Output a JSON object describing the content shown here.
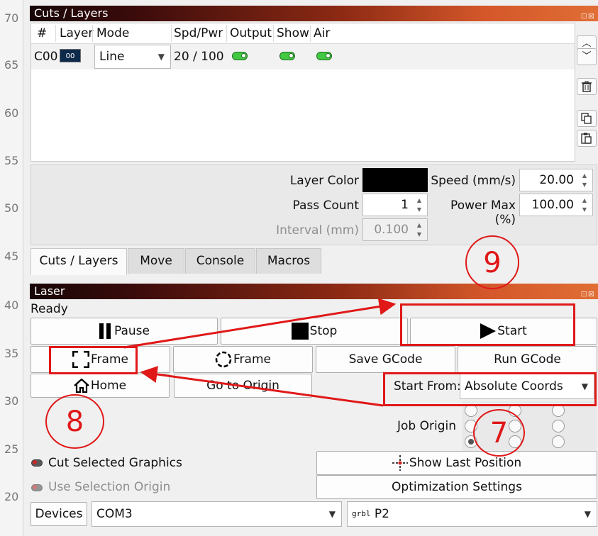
{
  "ruler": {
    "ticks": [
      "70",
      "65",
      "60",
      "55",
      "50",
      "45",
      "40",
      "35",
      "30",
      "25",
      "20"
    ]
  },
  "cuts_panel": {
    "title": "Cuts / Layers",
    "columns": [
      "#",
      "Layer",
      "Mode",
      "Spd/Pwr",
      "Output",
      "Show",
      "Air"
    ],
    "rows": [
      {
        "id": "C00",
        "layer": "00",
        "layer_color": "#0d2a4a",
        "mode": "Line",
        "spd_pwr": "20 / 100",
        "output": true,
        "show": true,
        "air": true
      }
    ],
    "props": {
      "layer_color_label": "Layer Color",
      "layer_color": "#000000",
      "speed_label": "Speed (mm/s)",
      "speed_value": "20.00",
      "pass_count_label": "Pass Count",
      "pass_count_value": "1",
      "power_max_label": "Power Max (%)",
      "power_max_value": "100.00",
      "interval_label": "Interval (mm)",
      "interval_value": "0.100"
    },
    "tabs": [
      "Cuts / Layers",
      "Move",
      "Console",
      "Macros"
    ],
    "active_tab": "Cuts / Layers"
  },
  "laser_panel": {
    "title": "Laser",
    "status": "Ready",
    "buttons": {
      "pause": "Pause",
      "stop": "Stop",
      "start": "Start",
      "frame_rect": "Frame",
      "frame_circle": "Frame",
      "save_gcode": "Save GCode",
      "run_gcode": "Run GCode",
      "home": "Home",
      "go_origin": "Go to Origin",
      "show_last_position": "Show Last Position",
      "optimization": "Optimization Settings",
      "devices": "Devices"
    },
    "start_from_label": "Start From:",
    "start_from_value": "Absolute Coords",
    "job_origin_label": "Job Origin",
    "cut_selected_label": "Cut Selected Graphics",
    "use_selection_origin_label": "Use Selection Origin",
    "port_value": "COM3",
    "device_value": "P2",
    "device_brand": "grbl"
  },
  "annotations": {
    "circle_9": "9",
    "circle_8": "8",
    "circle_7": "7",
    "accent": "#e01818"
  }
}
